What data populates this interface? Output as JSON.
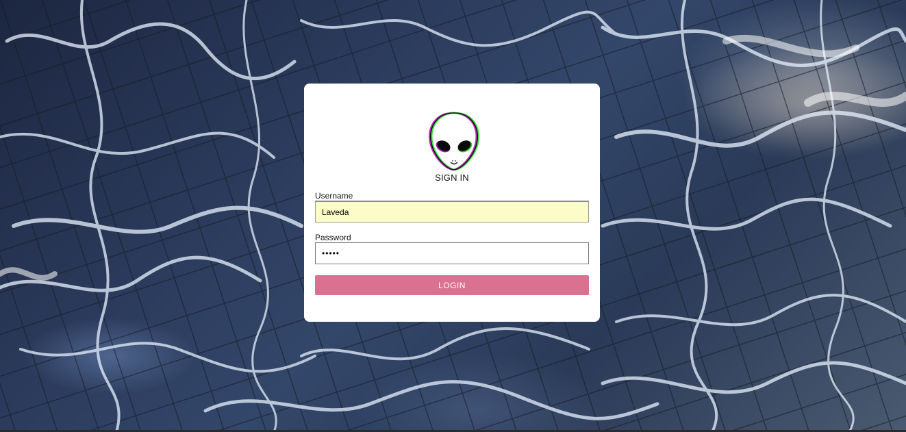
{
  "login": {
    "logo_icon": "alien-head-icon",
    "title": "SIGN IN",
    "username_label": "Username",
    "username_value": "Laveda",
    "password_label": "Password",
    "password_value": "•••••",
    "login_button": "LOGIN"
  },
  "colors": {
    "button": "#db7190",
    "autofill_field": "#fbfcc8",
    "card": "#ffffff",
    "background": "#2b3a5b"
  }
}
